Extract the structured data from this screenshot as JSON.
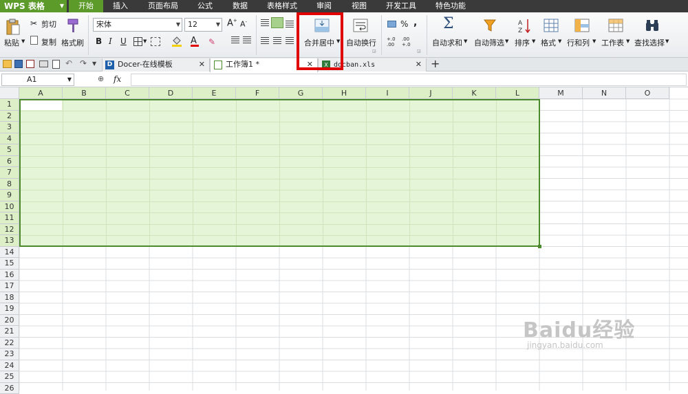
{
  "app": {
    "logo": "WPS 表格"
  },
  "menu": [
    "开始",
    "插入",
    "页面布局",
    "公式",
    "数据",
    "表格样式",
    "审阅",
    "视图",
    "开发工具",
    "特色功能"
  ],
  "ribbon": {
    "paste": "粘贴",
    "cut": "剪切",
    "copy": "复制",
    "format_painter": "格式刷",
    "font_name": "宋体",
    "font_size": "12",
    "bold": "B",
    "italic": "I",
    "underline": "U",
    "merge_center": "合并居中",
    "wrap_text": "自动换行",
    "percent": "%",
    "comma": ",",
    "dec_inc": "+.0 .00",
    "dec_dec": ".00 +.0",
    "autosum": "自动求和",
    "autofilter": "自动筛选",
    "sort": "排序",
    "format": "格式",
    "rows_cols": "行和列",
    "worksheet": "工作表",
    "find_select": "查找选择"
  },
  "tabs": [
    {
      "label": "Docer-在线模板"
    },
    {
      "label": "工作簿1 *"
    },
    {
      "label": "docban.xls"
    }
  ],
  "formula_bar": {
    "cell_ref": "A1",
    "fx": "fx",
    "value": ""
  },
  "columns": [
    "A",
    "B",
    "C",
    "D",
    "E",
    "F",
    "G",
    "H",
    "I",
    "J",
    "K",
    "L",
    "M",
    "N",
    "O"
  ],
  "rows": [
    "1",
    "2",
    "3",
    "4",
    "5",
    "6",
    "7",
    "8",
    "9",
    "10",
    "11",
    "12",
    "13",
    "14",
    "15",
    "16",
    "17",
    "18",
    "19",
    "20",
    "21",
    "22",
    "23",
    "24",
    "25",
    "26"
  ],
  "selection": {
    "range": "A1:L13",
    "active_cell": "A1"
  },
  "watermark": {
    "brand": "Baidu经验",
    "url": "jingyan.baidu.com"
  },
  "colors": {
    "accent": "#5c9a2a",
    "selection_fill": "#e5f5d8",
    "selection_border": "#4a8a2c",
    "highlight": "#e00000"
  }
}
